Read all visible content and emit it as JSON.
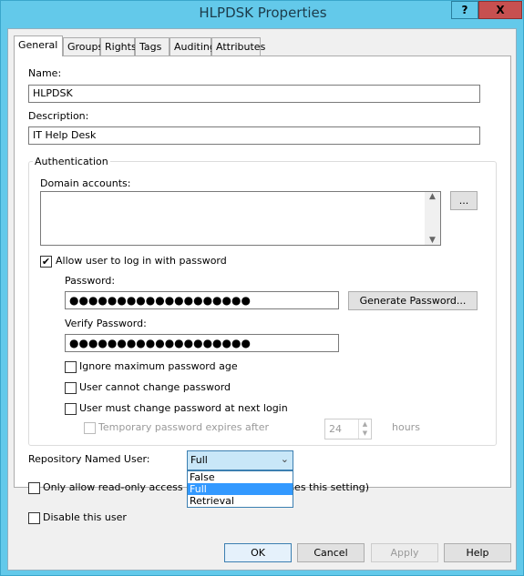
{
  "window": {
    "title": "HLPDSK Properties",
    "help": "?",
    "close": "X"
  },
  "tabs": [
    "General",
    "Groups",
    "Rights",
    "Tags",
    "Auditing",
    "Attributes"
  ],
  "general": {
    "name_label": "Name:",
    "name_value": "HLPDSK",
    "description_label": "Description:",
    "description_value": "IT Help Desk",
    "auth_group": "Authentication",
    "domain_accounts_label": "Domain accounts:",
    "browse_button": "...",
    "allow_password_label": "Allow user to log in with password",
    "allow_password_checked": true,
    "password_label": "Password:",
    "password_value": "●●●●●●●●●●●●●●●●●●●",
    "generate_button": "Generate Password...",
    "verify_label": "Verify Password:",
    "verify_value": "●●●●●●●●●●●●●●●●●●●",
    "ignore_age_label": "Ignore maximum password age",
    "cannot_change_label": "User cannot change password",
    "must_change_label": "User must change password at next login",
    "temp_expires_label": "Temporary password expires after",
    "temp_hours_value": "24",
    "hours_label": "hours",
    "repo_user_label": "Repository Named User:",
    "repo_user_value": "Full",
    "repo_user_options": [
      "False",
      "Full",
      "Retrieval"
    ],
    "readonly_label": "Only allow read-only access (Manager role bypasses this setting)",
    "disable_label": "Disable this user"
  },
  "buttons": {
    "ok": "OK",
    "cancel": "Cancel",
    "apply": "Apply",
    "help": "Help"
  },
  "colors": {
    "titlebar": "#63c9ea",
    "close": "#c75050",
    "selection": "#3399ff"
  }
}
